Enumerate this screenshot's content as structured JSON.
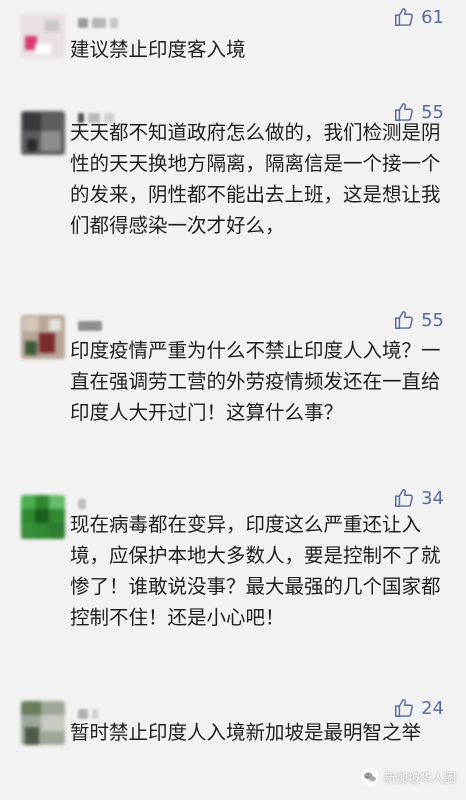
{
  "comments": [
    {
      "likes": "61",
      "text": "建议禁止印度客入境"
    },
    {
      "likes": "55",
      "text": "天天都不知道政府怎么做的，我们检测是阴性的天天换地方隔离，隔离信是一个接一个的发来，阴性都不能出去上班，这是想让我们都得感染一次才好么，"
    },
    {
      "likes": "55",
      "text": "印度疫情严重为什么不禁止印度人入境？一直在强调劳工营的外劳疫情频发还在一直给印度人大开过门！这算什么事？"
    },
    {
      "likes": "34",
      "text": "现在病毒都在变异，印度这么严重还让入境，应保护本地大多数人，要是控制不了就惨了！谁敢说没事？最大最强的几个国家都控制不住！还是小心吧！"
    },
    {
      "likes": "24",
      "text": "暂时禁止印度人入境新加坡是最明智之举"
    }
  ],
  "watermark": {
    "text": "新加坡华人圈",
    "icon": "wechat-icon"
  },
  "colors": {
    "like": "#586b9e",
    "background": "#f2f2f2",
    "text": "#1f1f1f"
  }
}
